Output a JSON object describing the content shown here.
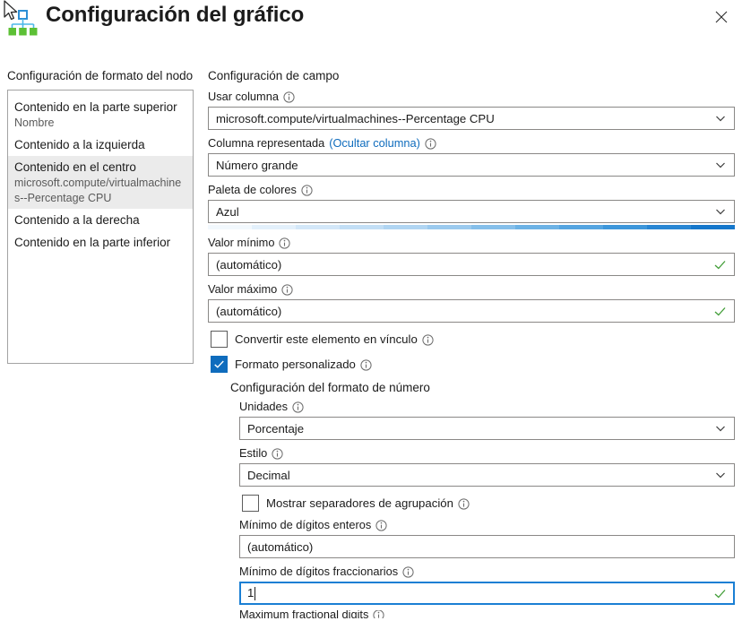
{
  "window": {
    "title": "Configuración del gráfico",
    "app_icon": "hierarchy-chart-icon",
    "close_label": "✕"
  },
  "left_panel": {
    "heading": "Configuración de formato del nodo",
    "items": [
      {
        "label": "Contenido en la parte superior",
        "sub": "Nombre",
        "selected": false
      },
      {
        "label": "Contenido a la izquierda",
        "sub": "",
        "selected": false
      },
      {
        "label": "Contenido en el centro",
        "sub": "microsoft.compute/virtualmachines--Percentage CPU",
        "selected": true
      },
      {
        "label": "Contenido a la derecha",
        "sub": "",
        "selected": false
      },
      {
        "label": "Contenido en la parte inferior",
        "sub": "",
        "selected": false
      }
    ]
  },
  "right_panel": {
    "heading": "Configuración de campo",
    "use_column": {
      "label": "Usar columna",
      "value": "microsoft.compute/virtualmachines--Percentage CPU"
    },
    "rendered_column": {
      "label": "Columna representada",
      "link": "(Ocultar columna)",
      "value": "Número grande"
    },
    "color_palette": {
      "label": "Paleta de colores",
      "value": "Azul",
      "swatches": [
        "#f2f8fd",
        "#e3f0fb",
        "#d3e7f8",
        "#c2def5",
        "#b0d5f2",
        "#9bcaee",
        "#85bfea",
        "#6cb2e5",
        "#54a4e0",
        "#3d96da",
        "#2886d3",
        "#1577cb"
      ]
    },
    "min_value": {
      "label": "Valor mínimo",
      "value": "(automático)"
    },
    "max_value": {
      "label": "Valor máximo",
      "value": "(automático)"
    },
    "make_link": {
      "label": "Convertir este elemento en vínculo",
      "checked": false
    },
    "custom_format": {
      "label": "Formato personalizado",
      "checked": true
    },
    "number_format": {
      "heading": "Configuración del formato de número",
      "units": {
        "label": "Unidades",
        "value": "Porcentaje"
      },
      "style": {
        "label": "Estilo",
        "value": "Decimal"
      },
      "show_group_separators": {
        "label": "Mostrar separadores de agrupación",
        "checked": false
      },
      "min_integer_digits": {
        "label": "Mínimo de dígitos enteros",
        "value": "(automático)"
      },
      "min_fractional_digits": {
        "label": "Mínimo de dígitos fraccionarios",
        "value": "1",
        "focused": true
      },
      "max_fractional_digits": {
        "label": "Maximum fractional digits"
      }
    }
  },
  "colors": {
    "accent": "#0f6cbd",
    "focus_border": "#1a7fd4",
    "valid_check": "#3f9c35",
    "selected_row_bg": "#ebebeb"
  }
}
